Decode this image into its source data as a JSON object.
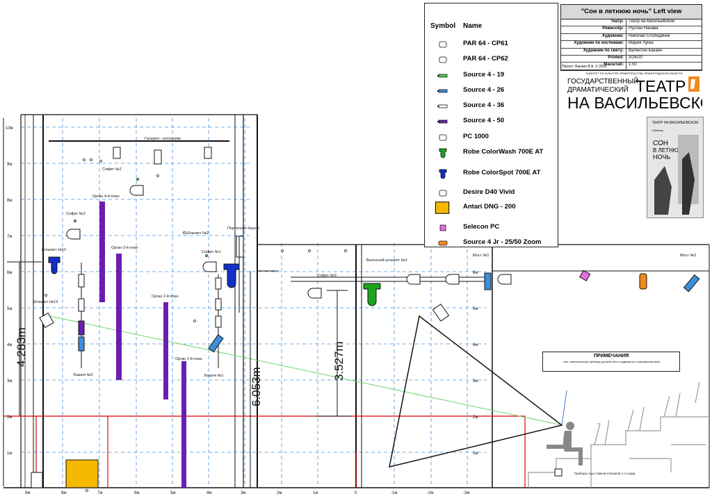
{
  "title_block": {
    "title": "\"Сон в летнюю ночь\" Left view",
    "rows": [
      {
        "key": "Театр:",
        "value": "Театр на Васильевском"
      },
      {
        "key": "Режиссёр:",
        "value": "Руслан Нанава"
      },
      {
        "key": "Художник:",
        "value": "Николай Слободяник"
      },
      {
        "key": "Художник по костюмам:",
        "value": "Мария Лукка"
      },
      {
        "key": "Художник по свету:",
        "value": "Валентин Бакаин"
      },
      {
        "key": "Printed:",
        "value": "3/26/20"
      },
      {
        "key": "Масштаб:",
        "value": "1:50"
      }
    ],
    "project": "Проект: Бакаин В.А. © 2020"
  },
  "logo": {
    "top_line": "КОМИТЕТ ПО КУЛЬТУРЕ ПРАВИТЕЛЬСТВА ЛЕНИНГРАДСКОЙ ОБЛАСТИ",
    "line1": "ГОСУДАРСТВЕННЫЙ",
    "line2": "ДРАМАТИЧЕСКИЙ",
    "big1": "ТЕАТР",
    "big2": "НА ВАСИЛЬЕВСКОМ"
  },
  "poster": {
    "top": "ТЕАТР НА ВАСИЛЬЕВСКОМ",
    "author": "У.Шекспир",
    "title1": "СОН",
    "title2": "В ЛЕТНЮЮ",
    "title3": "НОЧЬ"
  },
  "legend": {
    "symbol_header": "Symbol",
    "name_header": "Name",
    "items": [
      {
        "name": "PAR 64 - CP61",
        "icon": "par64-cp61-icon",
        "color": "#ffffff"
      },
      {
        "name": "PAR 64 - CP62",
        "icon": "par64-cp62-icon",
        "color": "#ffffff"
      },
      {
        "name": "Source 4 - 19",
        "icon": "source4-19-icon",
        "color": "#4fd14f"
      },
      {
        "name": "Source 4 - 26",
        "icon": "source4-26-icon",
        "color": "#3b8fd9"
      },
      {
        "name": "Source 4 - 36",
        "icon": "source4-36-icon",
        "color": "#ffffff"
      },
      {
        "name": "Source 4 - 50",
        "icon": "source4-50-icon",
        "color": "#6a1fb0"
      },
      {
        "name": "PC 1000",
        "icon": "pc1000-icon",
        "color": "#ffffff"
      },
      {
        "name": "Robe ColorWash 700E AT",
        "icon": "colorwash-icon",
        "color": "#1aa51a"
      },
      {
        "name": "Robe ColorSpot 700E AT",
        "icon": "colorspot-icon",
        "color": "#1430c8"
      },
      {
        "name": "Desire D40 Vivid",
        "icon": "desire-d40-icon",
        "color": "#ffffff"
      },
      {
        "name": "Antari DNG - 200",
        "icon": "antari-icon",
        "color": "#f5b800"
      },
      {
        "name": "Selecon PC",
        "icon": "selecon-icon",
        "color": "#e070e0"
      },
      {
        "name": "Source 4 Jr - 25/50 Zoom",
        "icon": "source4jr-icon",
        "color": "#f08a1e"
      }
    ]
  },
  "notes": {
    "title": "ПРИМЕЧАНИЯ",
    "body": "- все осветительные приборы должны быть подвешены и направлены вниз"
  },
  "y_axis_labels": [
    "1м",
    "2м",
    "3м",
    "4м",
    "5м",
    "6м",
    "7м",
    "8м",
    "9м",
    "10м"
  ],
  "x_axis_labels": [
    "9м",
    "8м",
    "7м",
    "6м",
    "5м",
    "4м",
    "3м",
    "2м",
    "1м",
    "0",
    "-1м",
    "-2м",
    "-3м"
  ],
  "right_scale_labels": [
    "1м",
    "2м",
    "3м",
    "4м",
    "5м",
    "6м"
  ],
  "dimensions": {
    "d1": "4.283m",
    "d2": "6.053m",
    "d3": "3.527m"
  },
  "labels": {
    "gallery": "Галерея - колосники",
    "sofit2": "Софит №2",
    "sofit3": "Софит №3",
    "sofit1": "Софит №1",
    "sofit0": "Софит №0",
    "organ4": "Орган 4-й план",
    "organ3": "Орган 3-й план",
    "organ2": "Орган 2-й план",
    "organ1": "Орган 1-й план",
    "shtanket12": "Штанкет №12",
    "shtanket13": "Штанкет №13",
    "shtanket2": "Штанкет №2",
    "portal": "Порталная башня",
    "tower2": "Башня №2",
    "tower1": "Башня №1",
    "vynos": "Выносной штанкет №3",
    "most1": "Мост №1",
    "most2": "Мост №2",
    "pribory": "Приборы под ставком (галерея) 1-го ряда"
  }
}
